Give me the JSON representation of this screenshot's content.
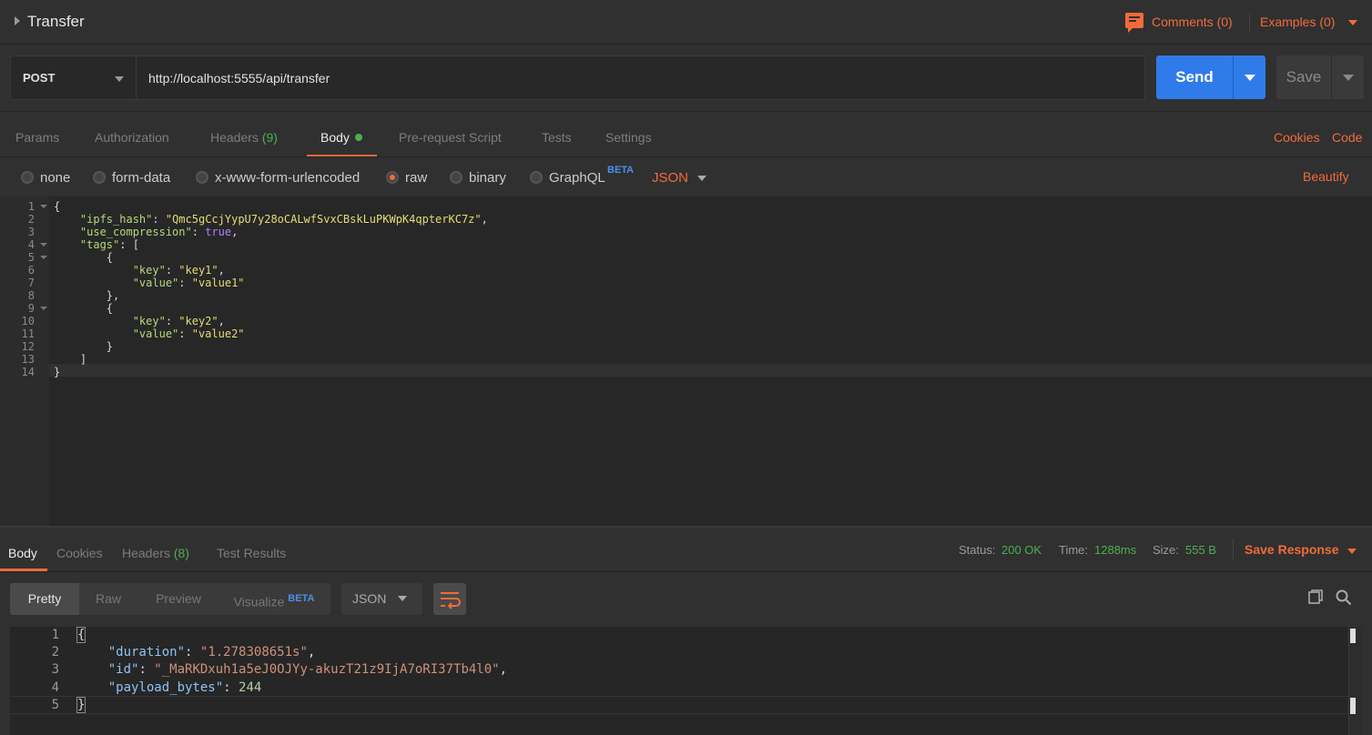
{
  "header": {
    "title": "Transfer",
    "comments": "Comments (0)",
    "examples": "Examples (0)"
  },
  "request": {
    "method": "POST",
    "url": "http://localhost:5555/api/transfer",
    "send": "Send",
    "save": "Save"
  },
  "req_tabs": {
    "params": "Params",
    "authorization": "Authorization",
    "headers": "Headers",
    "headers_count": "(9)",
    "body": "Body",
    "prerequest": "Pre-request Script",
    "tests": "Tests",
    "settings": "Settings",
    "cookies": "Cookies",
    "code": "Code"
  },
  "body_types": {
    "none": "none",
    "form_data": "form-data",
    "urlencoded": "x-www-form-urlencoded",
    "raw": "raw",
    "binary": "binary",
    "graphql": "GraphQL",
    "beta": "BETA",
    "format": "JSON",
    "beautify": "Beautify",
    "selected": "raw"
  },
  "editor_lines": [
    "{",
    "    \"ipfs_hash\": \"Qmc5gCcjYypU7y28oCALwfSvxCBskLuPKWpK4qpterKC7z\",",
    "    \"use_compression\": true,",
    "    \"tags\": [",
    "        {",
    "            \"key\": \"key1\",",
    "            \"value\": \"value1\"",
    "        },",
    "        {",
    "            \"key\": \"key2\",",
    "            \"value\": \"value2\"",
    "        }",
    "    ]",
    "}"
  ],
  "response": {
    "tabs": {
      "body": "Body",
      "cookies": "Cookies",
      "headers": "Headers",
      "headers_count": "(8)",
      "test_results": "Test Results"
    },
    "status_label": "Status:",
    "status": "200 OK",
    "time_label": "Time:",
    "time": "1288ms",
    "size_label": "Size:",
    "size": "555 B",
    "save_response": "Save Response",
    "views": {
      "pretty": "Pretty",
      "raw": "Raw",
      "preview": "Preview",
      "visualize": "Visualize",
      "beta": "BETA"
    },
    "format": "JSON",
    "body": {
      "duration": "1.278308651s",
      "id": "_MaRKDxuh1a5eJ0OJYy-akuzT21z9IjA7oRI37Tb4l0",
      "payload_bytes": "244"
    }
  },
  "colors": {
    "accent": "#f26b3a",
    "send": "#2f7bea",
    "success": "#4caf50"
  }
}
